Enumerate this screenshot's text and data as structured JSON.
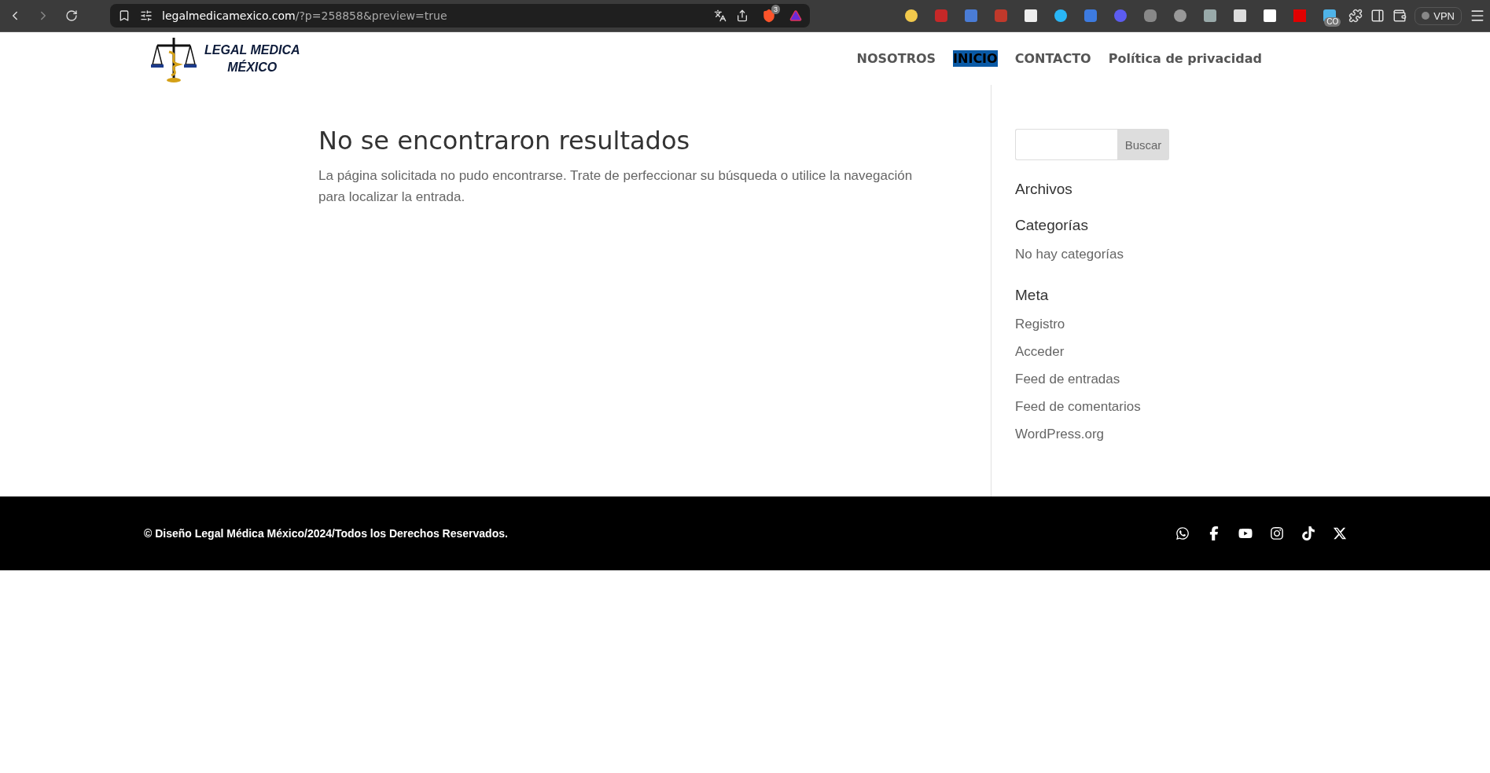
{
  "browser": {
    "url_host": "legalmedicamexico.com",
    "url_path": "/?p=258858&preview=true",
    "shield_badge": "3",
    "extension_badge": "CO",
    "vpn_label": "VPN"
  },
  "header": {
    "logo_lines": [
      "LEGAL MEDICA",
      "MÉXICO"
    ],
    "nav": [
      {
        "label": "NOSOTROS",
        "selected": false
      },
      {
        "label": "INICIO",
        "selected": true
      },
      {
        "label": "CONTACTO",
        "selected": false
      },
      {
        "label": "Política de privacidad",
        "selected": false
      }
    ]
  },
  "main": {
    "title": "No se encontraron resultados",
    "message": "La página solicitada no pudo encontrarse. Trate de perfeccionar su búsqueda o utilice la navegación para localizar la entrada."
  },
  "sidebar": {
    "search_button": "Buscar",
    "widgets": [
      {
        "title": "Archivos"
      },
      {
        "title": "Categorías",
        "items": [
          "No hay categorías"
        ]
      },
      {
        "title": "Meta",
        "items": [
          "Registro",
          "Acceder",
          "Feed de entradas",
          "Feed de comentarios",
          "WordPress.org"
        ]
      }
    ]
  },
  "footer": {
    "copyright": "© Diseño Legal Médica México/2024/Todos los Derechos Reservados."
  }
}
